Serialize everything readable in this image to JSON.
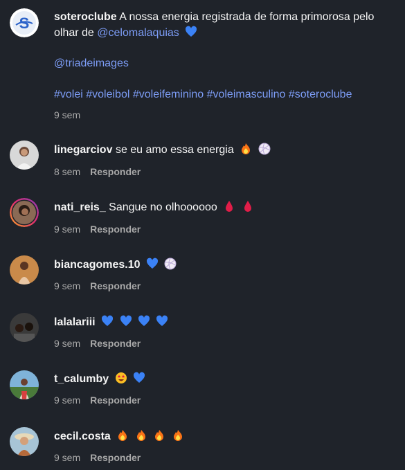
{
  "caption": {
    "username": "soteroclube",
    "text": "A nossa energia registrada de forma primorosa pelo olhar de",
    "mention1": "@celomalaquias",
    "mention2": "@triadeimages",
    "hashtags": "#volei #voleibol #voleifeminino #voleimasculino #soteroclube",
    "time": "9 sem"
  },
  "reply_label": "Responder",
  "comments": [
    {
      "username": "linegarciov",
      "text": "se eu amo essa energia",
      "emojis": [
        "fire",
        "volleyball"
      ],
      "time": "8 sem"
    },
    {
      "username": "nati_reis_",
      "text": "Sangue no olhoooooo",
      "emojis": [
        "drop-of-blood",
        "drop-of-blood"
      ],
      "time": "9 sem"
    },
    {
      "username": "biancagomes.10",
      "text": "",
      "emojis": [
        "blue-heart",
        "volleyball"
      ],
      "time": "9 sem"
    },
    {
      "username": "lalalariii",
      "text": "",
      "emojis": [
        "blue-heart",
        "blue-heart",
        "blue-heart",
        "blue-heart"
      ],
      "time": "9 sem"
    },
    {
      "username": "t_calumby",
      "text": "",
      "emojis": [
        "star-struck",
        "blue-heart"
      ],
      "time": "9 sem"
    },
    {
      "username": "cecil.costa",
      "text": "",
      "emojis": [
        "fire",
        "fire",
        "fire",
        "fire"
      ],
      "time": "9 sem"
    }
  ],
  "colors": {
    "background": "#1f232a",
    "link": "#7c9cf5",
    "muted": "#a8a8a8"
  }
}
